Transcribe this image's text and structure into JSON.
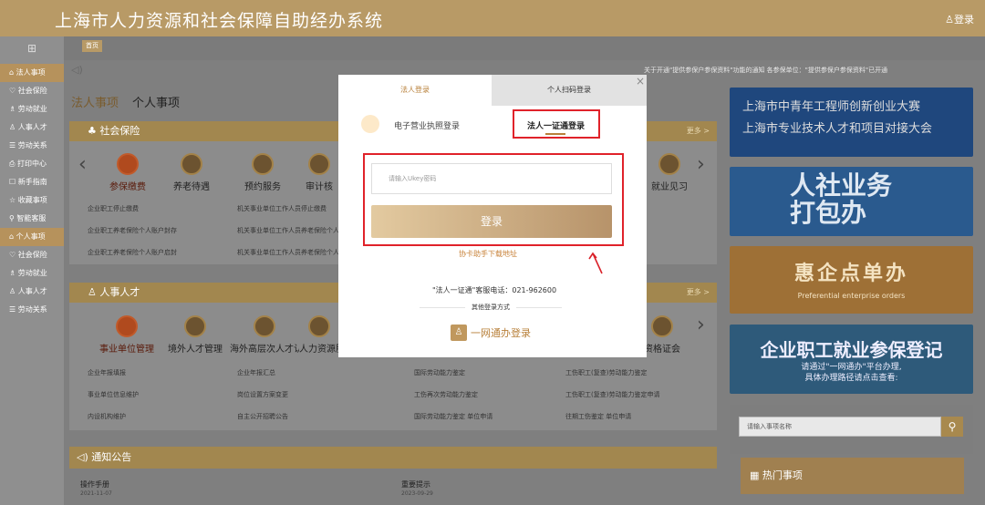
{
  "header": {
    "title": "上海市人力资源和社会保障自助经办系统",
    "login": "♙登录"
  },
  "sidebar": {
    "toggle": "⊞",
    "items": [
      {
        "label": "⌂ 法人事项",
        "active": true
      },
      {
        "label": "♡ 社会保险"
      },
      {
        "label": "♗ 劳动就业"
      },
      {
        "label": "♙ 人事人才"
      },
      {
        "label": "☰ 劳动关系"
      },
      {
        "label": "⎙ 打印中心"
      },
      {
        "label": "☐ 新手指南"
      },
      {
        "label": "☆ 收藏事项"
      },
      {
        "label": "⚲ 智能客服"
      },
      {
        "label": "⌂ 个人事项",
        "active": true
      },
      {
        "label": "♡ 社会保险"
      },
      {
        "label": "♗ 劳动就业"
      },
      {
        "label": "♙ 人事人才"
      },
      {
        "label": "☰ 劳动关系"
      }
    ]
  },
  "tabs": {
    "home": "首页"
  },
  "crumb": {
    "icon": "◁)"
  },
  "notice_ticker": "关于开通\"提供参保户参保资料\"功能的通知 各参保单位：\"提供参保户参保资料\"已开通",
  "main_tabs": {
    "legal": "法人事项",
    "personal": "个人事项"
  },
  "sections": {
    "social": {
      "title": "♣ 社会保险",
      "more": "更多 >",
      "services": [
        "参保缴费",
        "养老待遇",
        "预约服务",
        "审计核"
      ],
      "right_service": "就业见习",
      "links": [
        [
          "企业职工停止缴费",
          "机关事业单位工作人员停止缴费"
        ],
        [
          "企业职工养老保险个人账户封存",
          "机关事业单位工作人员养老保险个人账户封存"
        ],
        [
          "企业职工养老保险个人账户启封",
          "机关事业单位工作人员养老保险个人账户启封"
        ]
      ]
    },
    "hr": {
      "title": "♙ 人事人才",
      "more": "更多 >",
      "services": [
        "事业单位管理",
        "境外人才管理",
        "海外高层次人才认",
        "人力资源服"
      ],
      "right_service": "资格证会",
      "links": [
        [
          "企业年报填报",
          "企业年报汇总"
        ],
        [
          "事业单位信息维护",
          "岗位设置方案变更"
        ],
        [
          "内设机构维护",
          "自主公开招聘公告"
        ]
      ],
      "links_right": [
        [
          "国际劳动能力鉴定",
          "工伤职工(复查)劳动能力鉴定"
        ],
        [
          "工伤再次劳动能力鉴定",
          "工伤职工(复查)劳动能力鉴定申请"
        ],
        [
          "国际劳动能力鉴定 单位申请",
          "往期工伤鉴定 单位申请"
        ]
      ]
    }
  },
  "notice": {
    "title": "◁) 通知公告",
    "items": [
      {
        "title": "操作手册",
        "date": "2021-11-07"
      },
      {
        "title": "重要提示",
        "date": "2023-09-29"
      }
    ]
  },
  "banners": {
    "b1": [
      "上海市中青年工程师创新创业大赛",
      "上海市专业技术人才和项目对接大会"
    ],
    "b2": [
      "人社业务",
      "打包办"
    ],
    "b3": {
      "big": "惠企点单办",
      "small": "Preferential enterprise orders"
    },
    "b4": {
      "big": "企业职工就业参保登记",
      "small1": "请通过\"一网通办\"平台办理,",
      "small2": "具体办理路径请点击查看:"
    }
  },
  "right_search": {
    "placeholder": "请输入事项名称",
    "button": "⚲"
  },
  "hot": {
    "label": "▦ 热门事项"
  },
  "modal": {
    "tab_legal": "法人登录",
    "tab_scan": "个人扫码登录",
    "close": "×",
    "option_license": "电子营业执照登录",
    "option_cert": "法人一证通登录",
    "ukey_placeholder": "请输入Ukey密码",
    "login_button": "登录",
    "helper": "协卡助手下载地址",
    "hotline": "\"法人一证通\"客服电话：021-962600",
    "other_methods": "其他登录方式",
    "ywtb": "一网通办登录",
    "ywtb_icon": "♙"
  }
}
